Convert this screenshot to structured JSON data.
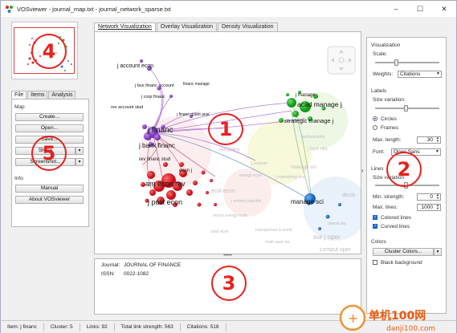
{
  "window": {
    "title": "VOSviewer - journal_map.txt - journal_network_sparse.txt",
    "controls": {
      "minimize": "–",
      "maximize": "☐",
      "close": "✕"
    }
  },
  "left_panel": {
    "tabs": [
      "File",
      "Items",
      "Analysis"
    ],
    "map_section": "Map",
    "buttons": {
      "create": "Create...",
      "open": "Open...",
      "save": "Save...",
      "share": "Share",
      "screenshot": "Screenshot..."
    },
    "info_section": "Info",
    "manual": "Manual",
    "about": "About VOSviewer"
  },
  "vis_tabs": [
    "Network Visualization",
    "Overlay Visualization",
    "Density Visualization"
  ],
  "network_labels": {
    "j_account_econ": "j account econ",
    "j_bus_financ_account": "j bus financ account",
    "financ_manage": "financ manage",
    "j_corp_financ": "j corp financ",
    "rev_account_stud": "rev account stud",
    "j_financ_quant_anal": "j financ quant anal",
    "j_financ": "j financ",
    "j_bank_financ": "j bank financ",
    "rev_financ_stud": "rev financ stud",
    "econ_j": "econ j",
    "j_financ_econ": "j financ econ",
    "am_econ_rev": "am econ rev",
    "j_polit_econ": "j polit econ",
    "ecol_econ": "ecol econ",
    "j_manage": "j manage",
    "acad_manage_j": "acad manage j",
    "strategic_manage_j": "strategic manage j",
    "j_bus_res": "j bus res",
    "manage_sci": "manage sci",
    "j_marketing_res": "j marketing res",
    "decis": "decis",
    "transport_res": "transportes b-meth",
    "math_oper_res": "math oper res",
    "eur_j_oper": "eur j oper",
    "comput_oper": "comput oper",
    "res_policy": "res policy",
    "energy_econ": "energy econ",
    "technovation": "technovation",
    "j_environ_psychol": "j environ psychol",
    "resour_energy_econ": "resour energy econ",
    "land_econ": "land econ",
    "manage_sci_small": "manage sci",
    "j_consum": "j consum",
    "operat_res": "operat res"
  },
  "info": {
    "journal_label": "Journal:",
    "journal_value": "JOURNAL OF FINANCE",
    "issn_label": "ISSN:",
    "issn_value": "0022-1082"
  },
  "splitter": "•••••",
  "right_panel": {
    "visualization": "Visualization",
    "scale": "Scale:",
    "weights_label": "Weights:",
    "weights_value": "Citations",
    "labels": "Labels",
    "size_variation": "Size variation:",
    "circles": "Circles",
    "frames": "Frames",
    "max_length_label": "Max. length:",
    "max_length_value": "30",
    "font_label": "Font:",
    "font_value": "Open Sans",
    "lines": "Lines",
    "lines_size_variation": "Size variation:",
    "min_strength_label": "Min. strength:",
    "min_strength_value": "0",
    "max_lines_label": "Max. lines:",
    "max_lines_value": "1000",
    "colored_lines": "Colored lines",
    "curved_lines": "Curved lines",
    "colors": "Colors",
    "cluster_colors": "Cluster Colors...",
    "black_background": "Black background"
  },
  "status_bar": {
    "item": "Item:  j financ",
    "cluster": "Cluster:  5",
    "links": "Links:  92",
    "total_link_strength": "Total link strength:  563",
    "citations": "Citations:  518"
  },
  "annotations": [
    "1",
    "2",
    "3",
    "4",
    "5"
  ],
  "watermark": {
    "brand": "单机100网",
    "url": "danji100.com"
  },
  "colors": {
    "cluster_purple": "#9a4fd1",
    "cluster_red": "#e0202a",
    "cluster_green": "#1fae1f",
    "cluster_blue": "#2a7fd4",
    "cluster_yellow": "#dede3a",
    "annotation_red": "#e8201c"
  }
}
